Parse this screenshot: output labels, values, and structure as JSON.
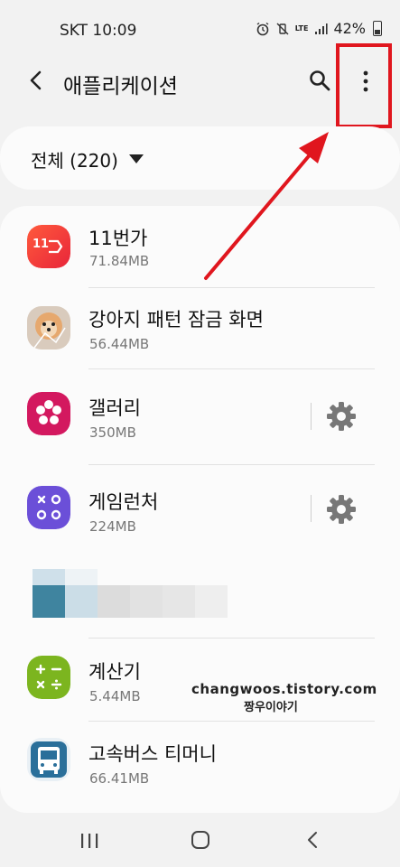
{
  "status_bar": {
    "carrier_time": "SKT 10:09",
    "network_label": "LTE",
    "battery": "42%"
  },
  "app_bar": {
    "title": "애플리케이션"
  },
  "filter": {
    "label": "전체 (220)"
  },
  "apps": [
    {
      "name": "11번가",
      "size": "71.84MB",
      "icon": "11st-app-icon",
      "icon_text": "11",
      "has_settings": false
    },
    {
      "name": "강아지 패턴 잠금 화면",
      "size": "56.44MB",
      "icon": "puppy-lock-app-icon",
      "has_settings": false
    },
    {
      "name": "갤러리",
      "size": "350MB",
      "icon": "gallery-app-icon",
      "has_settings": true
    },
    {
      "name": "게임런처",
      "size": "224MB",
      "icon": "game-launcher-app-icon",
      "has_settings": true
    },
    {
      "name": "계산기",
      "size": "5.44MB",
      "icon": "calculator-app-icon",
      "has_settings": false
    },
    {
      "name": "고속버스 티머니",
      "size": "66.41MB",
      "icon": "bus-app-icon",
      "has_settings": false
    }
  ],
  "watermark": {
    "line1": "changwoos.tistory.com",
    "line2": "짱우이야기"
  },
  "colors": {
    "highlight": "#e0161e",
    "background": "#f2f2f2",
    "card": "#fbfbfb"
  }
}
